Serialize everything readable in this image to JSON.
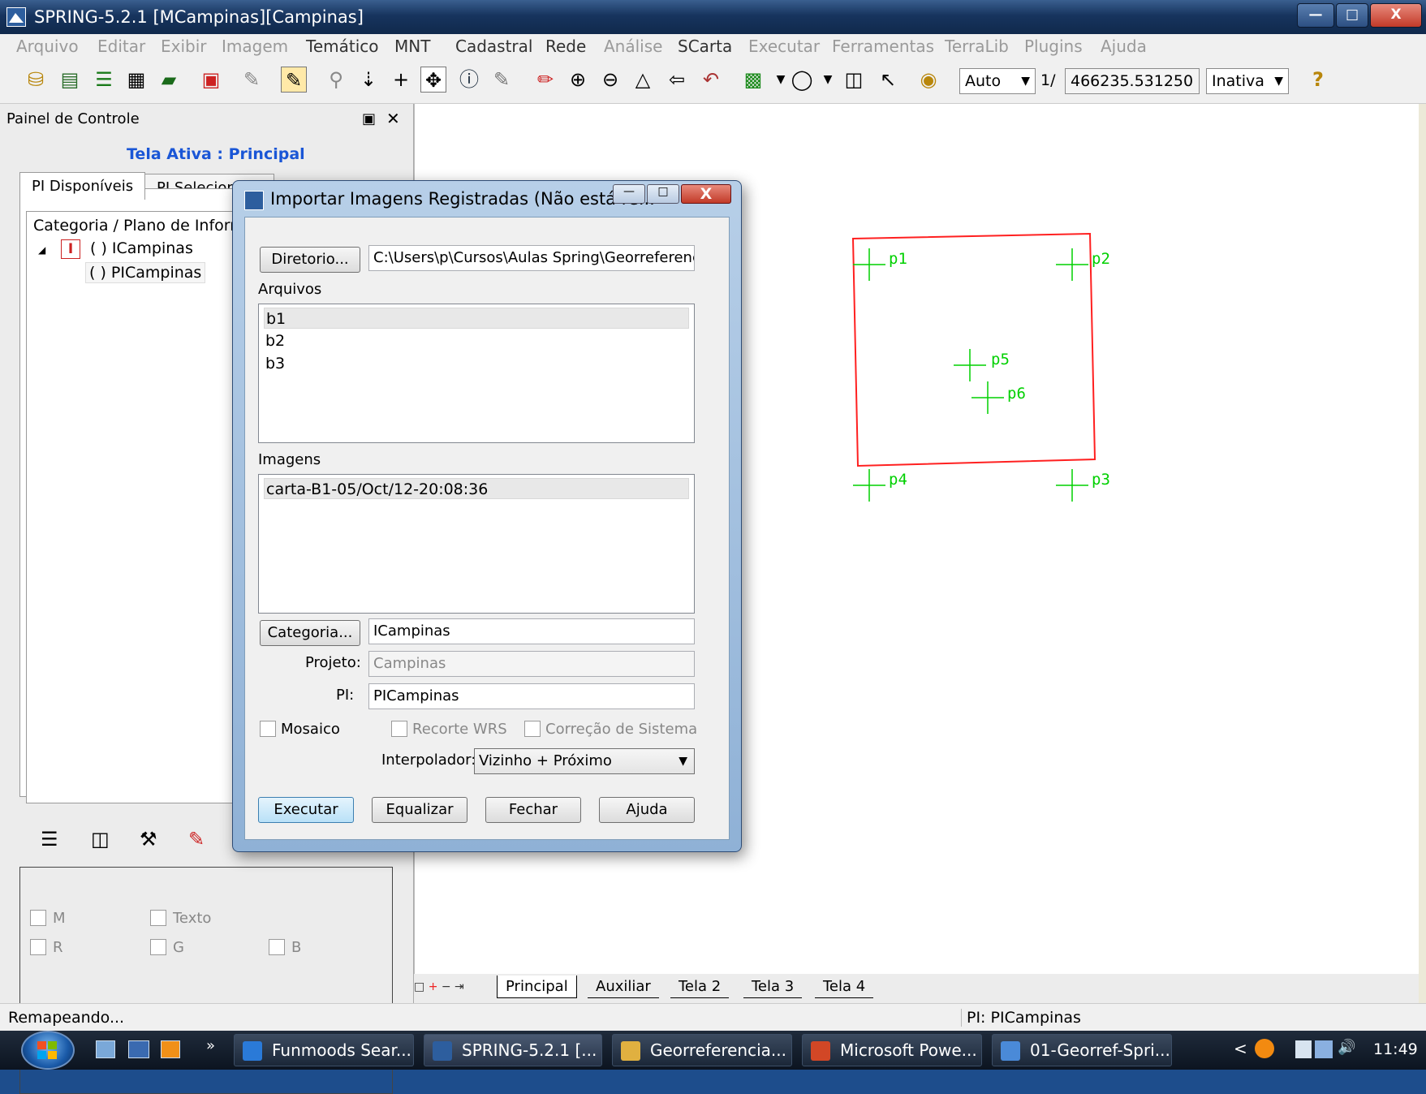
{
  "window": {
    "title": "SPRING-5.2.1 [MCampinas][Campinas]",
    "minimize": "—",
    "maximize": "□",
    "close": "X"
  },
  "menu": [
    "Arquivo",
    "Editar",
    "Exibir",
    "Imagem",
    "Temático",
    "MNT",
    "Cadastral",
    "Rede",
    "Análise",
    "SCarta",
    "Executar",
    "Ferramentas",
    "TerraLib",
    "Plugins",
    "Ajuda"
  ],
  "toolbar": {
    "zoom_mode": "Auto",
    "scale_prefix": "1/",
    "scale_value": "466235.531250",
    "state": "Inativa",
    "help_glyph": "?"
  },
  "panel": {
    "header": "Painel de Controle",
    "active_screen": "Tela Ativa : Principal",
    "tabs": [
      "PI Disponíveis",
      "PI Selecionados"
    ],
    "tree_header": "Categoria / Plano de Informação",
    "tree": {
      "category_icon_letter": "I",
      "category": "( ) ICampinas",
      "plan": "( ) PICampinas"
    },
    "checks": {
      "m": "M",
      "texto": "Texto",
      "r": "R",
      "g": "G",
      "b": "B"
    }
  },
  "canvas": {
    "points": [
      "p1",
      "p2",
      "p5",
      "p6",
      "p4",
      "p3"
    ],
    "tabs": [
      "Principal",
      "Auxiliar",
      "Tela 2",
      "Tela 3",
      "Tela 4"
    ]
  },
  "status": {
    "left": "Remapeando...",
    "right": "PI: PICampinas"
  },
  "dialog": {
    "title": "Importar Imagens Registradas (Não está re...",
    "directory_button": "Diretorio...",
    "directory_path": "C:\\Users\\p\\Cursos\\Aulas Spring\\Georreferenciar",
    "files_label": "Arquivos",
    "files": [
      "b1",
      "b2",
      "b3"
    ],
    "images_label": "Imagens",
    "images": [
      "carta-B1-05/Oct/12-20:08:36"
    ],
    "category_button": "Categoria...",
    "category_value": "ICampinas",
    "project_label": "Projeto:",
    "project_value": "Campinas",
    "pi_label": "PI:",
    "pi_value": "PICampinas",
    "mosaic": "Mosaico",
    "cut_wrs": "Recorte WRS",
    "system_correction": "Correção de Sistema",
    "interpolator_label": "Interpolador:",
    "interpolator_value": "Vizinho + Próximo",
    "buttons": {
      "execute": "Executar",
      "equalize": "Equalizar",
      "close": "Fechar",
      "help": "Ajuda"
    }
  },
  "taskbar": {
    "tasks": [
      "Funmoods Sear...",
      "SPRING-5.2.1 [...",
      "Georreferencia...",
      "Microsoft Powe...",
      "01-Georref-Spri..."
    ],
    "clock": "11:49",
    "chevron": "»",
    "tray_chevron": "<"
  }
}
